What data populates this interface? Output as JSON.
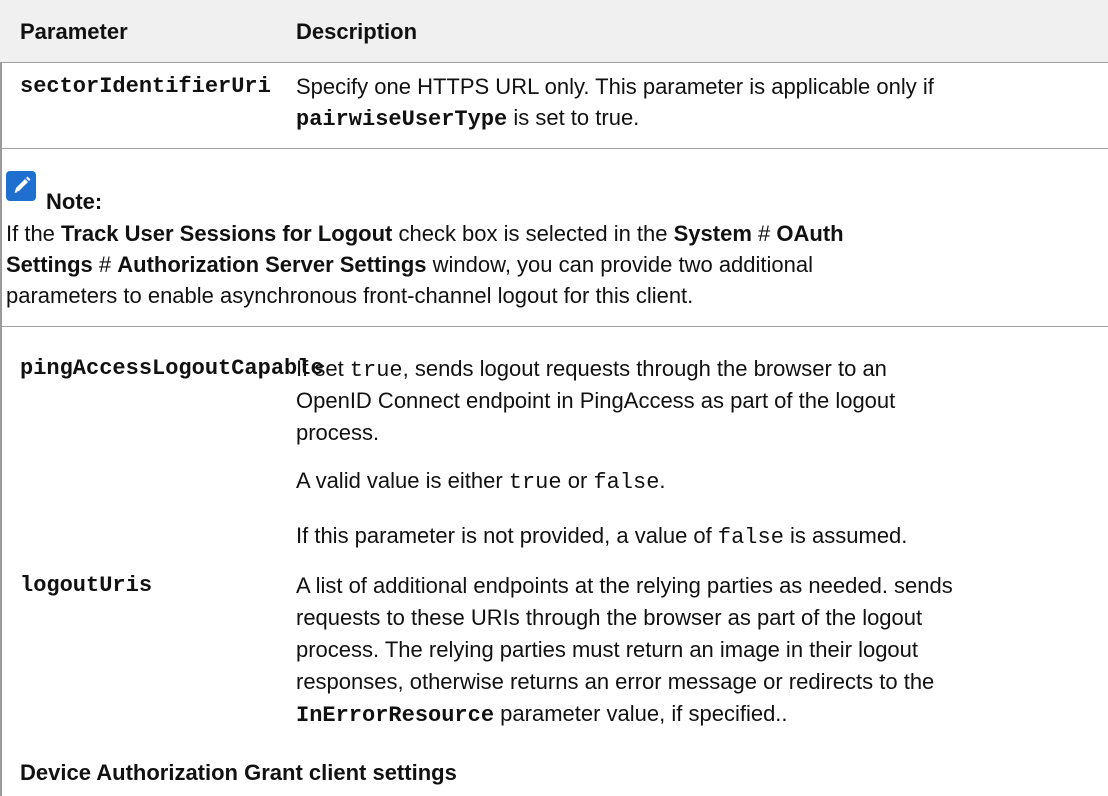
{
  "table": {
    "headers": [
      "Parameter",
      "Description"
    ]
  },
  "rows": {
    "sector": {
      "name": "sectorIdentifierUri",
      "line1": "Specify one HTTPS URL only. This parameter is applicable only if",
      "line2_code": "pairwiseUserType",
      "line2_rest": " is set to true."
    },
    "note": {
      "heading": "Note:",
      "l1_a": "If the ",
      "l1_b": "Track User Sessions for Logout",
      "l1_c": " check box is selected in the ",
      "l1_d": "System",
      "l1_e": " # ",
      "l1_f": "OAuth",
      "l2_a": "Settings",
      "l2_b": " # ",
      "l2_c": "Authorization Server Settings",
      "l2_d": " window, you can provide two additional",
      "l3": "parameters to enable asynchronous front-channel logout for this client."
    },
    "ping": {
      "name": "pingAccessLogoutCapable",
      "p1_prefix": "If set ",
      "p1_code": "true",
      "p1_rest": ",  sends logout requests through the browser to an",
      "p1_l2": "OpenID Connect endpoint in PingAccess as part of the logout",
      "p1_l3": "process.",
      "p2_a": "A valid value is either ",
      "p2_code1": "true",
      "p2_b": " or ",
      "p2_code2": "false",
      "p2_c": ".",
      "p3_a": "If this parameter is not provided, a value of ",
      "p3_code": "false",
      "p3_b": " is assumed."
    },
    "logout": {
      "name": "logoutUris",
      "l1": "A list of additional endpoints at the relying parties as needed.  sends",
      "l2": "requests to these URIs through the browser as part of the logout",
      "l3": "process. The relying parties must return an image in their logout",
      "l4": "responses, otherwise  returns an error message or redirects to the",
      "l5_code": "InErrorResource",
      "l5_rest": " parameter value, if specified.."
    }
  },
  "section": {
    "device_grant": "Device Authorization Grant client settings"
  },
  "colors": {
    "icon_blue": "#1e6fcf",
    "header_bg": "#f0f0f0",
    "rule": "#a0a0a0"
  },
  "icons": {
    "note": "pencil-note-icon"
  }
}
